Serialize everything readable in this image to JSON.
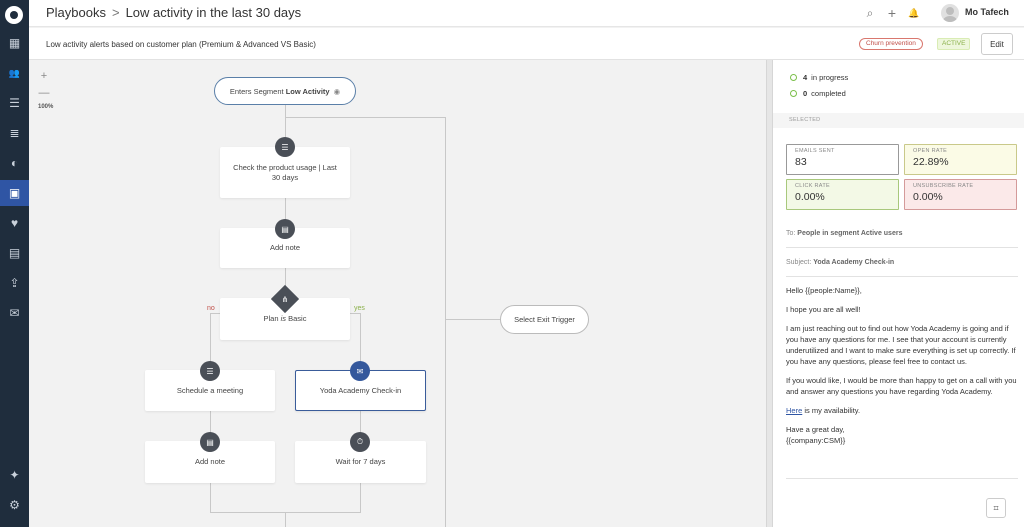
{
  "sidebar": {
    "items": [
      {
        "name": "sidebar-item-dashboard",
        "icon": "▦",
        "active": false
      },
      {
        "name": "sidebar-item-people",
        "icon": "👥",
        "active": false
      },
      {
        "name": "sidebar-item-segments",
        "icon": "☰",
        "active": false
      },
      {
        "name": "sidebar-item-lists",
        "icon": "≣",
        "active": false
      },
      {
        "name": "sidebar-item-analytics",
        "icon": "◐",
        "active": false
      },
      {
        "name": "sidebar-item-playbooks",
        "icon": "▣",
        "active": true
      },
      {
        "name": "sidebar-item-health",
        "icon": "♥",
        "active": false
      },
      {
        "name": "sidebar-item-calculator",
        "icon": "▤",
        "active": false
      },
      {
        "name": "sidebar-item-upload",
        "icon": "⇪",
        "active": false
      },
      {
        "name": "sidebar-item-messages",
        "icon": "✉",
        "active": false
      }
    ],
    "bottom": [
      {
        "name": "sidebar-item-tips",
        "icon": "✦"
      },
      {
        "name": "sidebar-item-settings",
        "icon": "⚙"
      }
    ]
  },
  "header": {
    "breadcrumb_root": "Playbooks",
    "breadcrumb_sep": ">",
    "title": "Low activity in the last 30 days",
    "user_name": "Mo Tafech",
    "icons": {
      "search": "⌕",
      "add": "+",
      "bell": "🔔"
    }
  },
  "subheader": {
    "description": "Low activity alerts based on customer plan (Premium & Advanced VS Basic)",
    "tag_churn": "Churn prevention",
    "tag_status": "ACTIVE",
    "edit_label": "Edit"
  },
  "canvas": {
    "zoom_in": "+",
    "zoom_out": "—",
    "zoom_level": "100%",
    "entry_prefix": "Enters Segment ",
    "entry_segment": "Low Activity",
    "nodes": {
      "check_usage": "Check the product usage | Last 30 days",
      "add_note_1": "Add note",
      "plan_prefix": "Plan ",
      "plan_is": "is",
      "plan_suffix": " Basic",
      "branch_no": "no",
      "branch_yes": "yes",
      "schedule_meeting": "Schedule a meeting",
      "yoda_checkin": "Yoda Academy Check-in",
      "add_note_2": "Add note",
      "wait": "Wait for 7 days",
      "exit_trigger": "Select Exit Trigger"
    }
  },
  "panel": {
    "in_progress_count": "4",
    "in_progress_label": "in progress",
    "completed_count": "0",
    "completed_label": "completed",
    "selected_label": "SELECTED",
    "metrics": {
      "emails_sent_label": "EMAILS SENT",
      "emails_sent_value": "83",
      "open_rate_label": "OPEN RATE",
      "open_rate_value": "22.89%",
      "click_rate_label": "CLICK RATE",
      "click_rate_value": "0.00%",
      "unsub_rate_label": "UNSUBSCRIBE RATE",
      "unsub_rate_value": "0.00%"
    },
    "to_label": "To:",
    "to_value": "People in segment Active users",
    "subject_label": "Subject:",
    "subject_value": "Yoda Academy Check-in",
    "email": {
      "greeting": "Hello {{people:Name}},",
      "p1": "I hope you are all well!",
      "p2": "I am just reaching out to find out how Yoda Academy is going and if you have any questions for me. I see that your account is currently underutilized and I want to make sure everything is set up correctly. If you have any questions, please feel free to contact us.",
      "p3": "If you would like, I would be more than happy to get on a call with you and answer any questions you have regarding Yoda Academy.",
      "link_text": "Here",
      "p4_rest": " is my availability.",
      "signoff": "Have a great day,",
      "signature": "{{company:CSM}}"
    }
  },
  "colors": {
    "sidebar_bg": "#1f2d3d",
    "accent": "#2f55a4",
    "open_rate_bg": "#fbfbe6",
    "click_rate_bg": "#f3f9e6",
    "unsub_rate_bg": "#fbe9e9"
  }
}
